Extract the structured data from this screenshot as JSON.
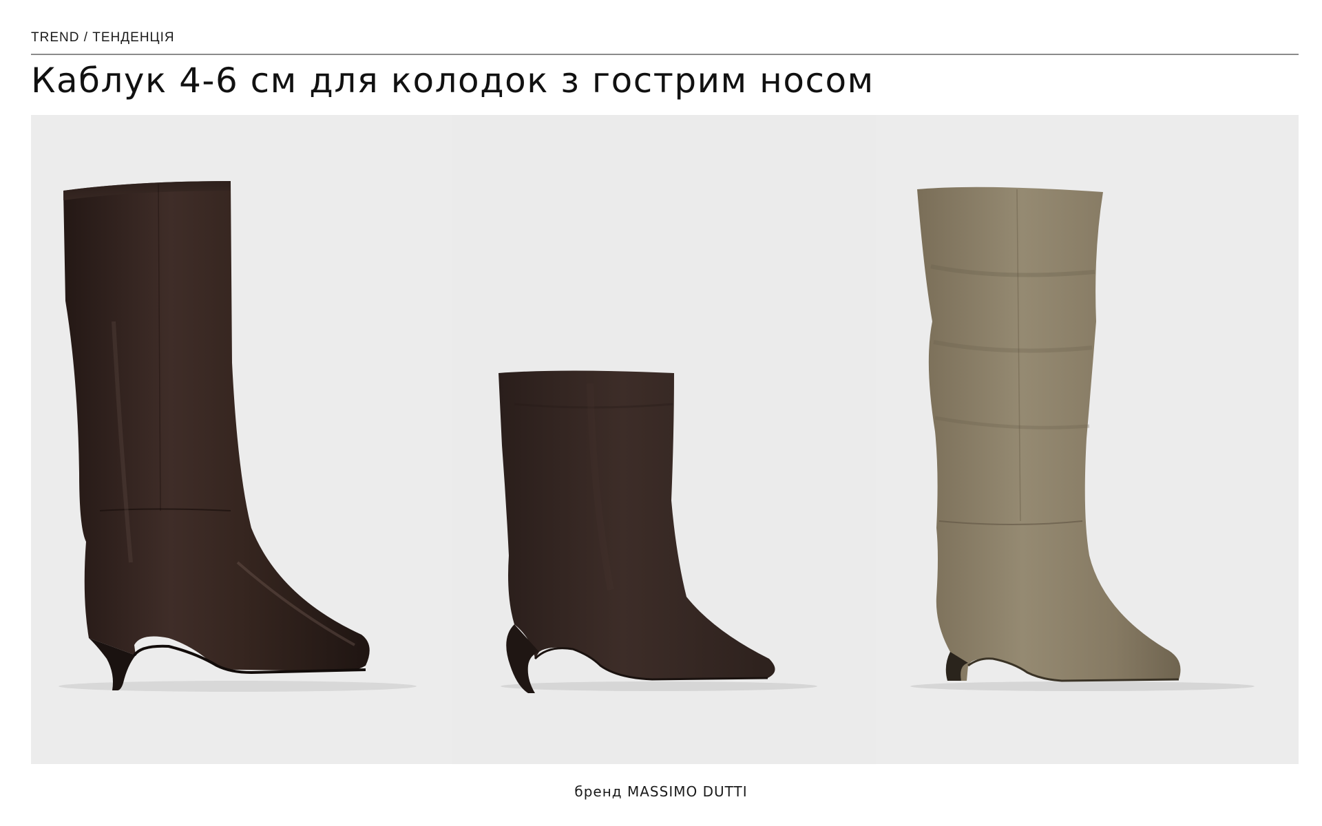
{
  "header": {
    "kicker": "TREND / ТЕНДЕНЦІЯ",
    "title": "Каблук 4-6 см для колодок з гострим носом"
  },
  "products": [
    {
      "icon": "tall-leather-boot-image",
      "color": "#3a2a26",
      "background": "#ececec"
    },
    {
      "icon": "suede-ankle-boot-image",
      "color": "#3a2a25",
      "background": "#ebebeb"
    },
    {
      "icon": "tall-suede-boot-image",
      "color": "#8a7e66",
      "background": "#ececec"
    }
  ],
  "footer": {
    "caption": "бренд MASSIMO DUTTI"
  }
}
